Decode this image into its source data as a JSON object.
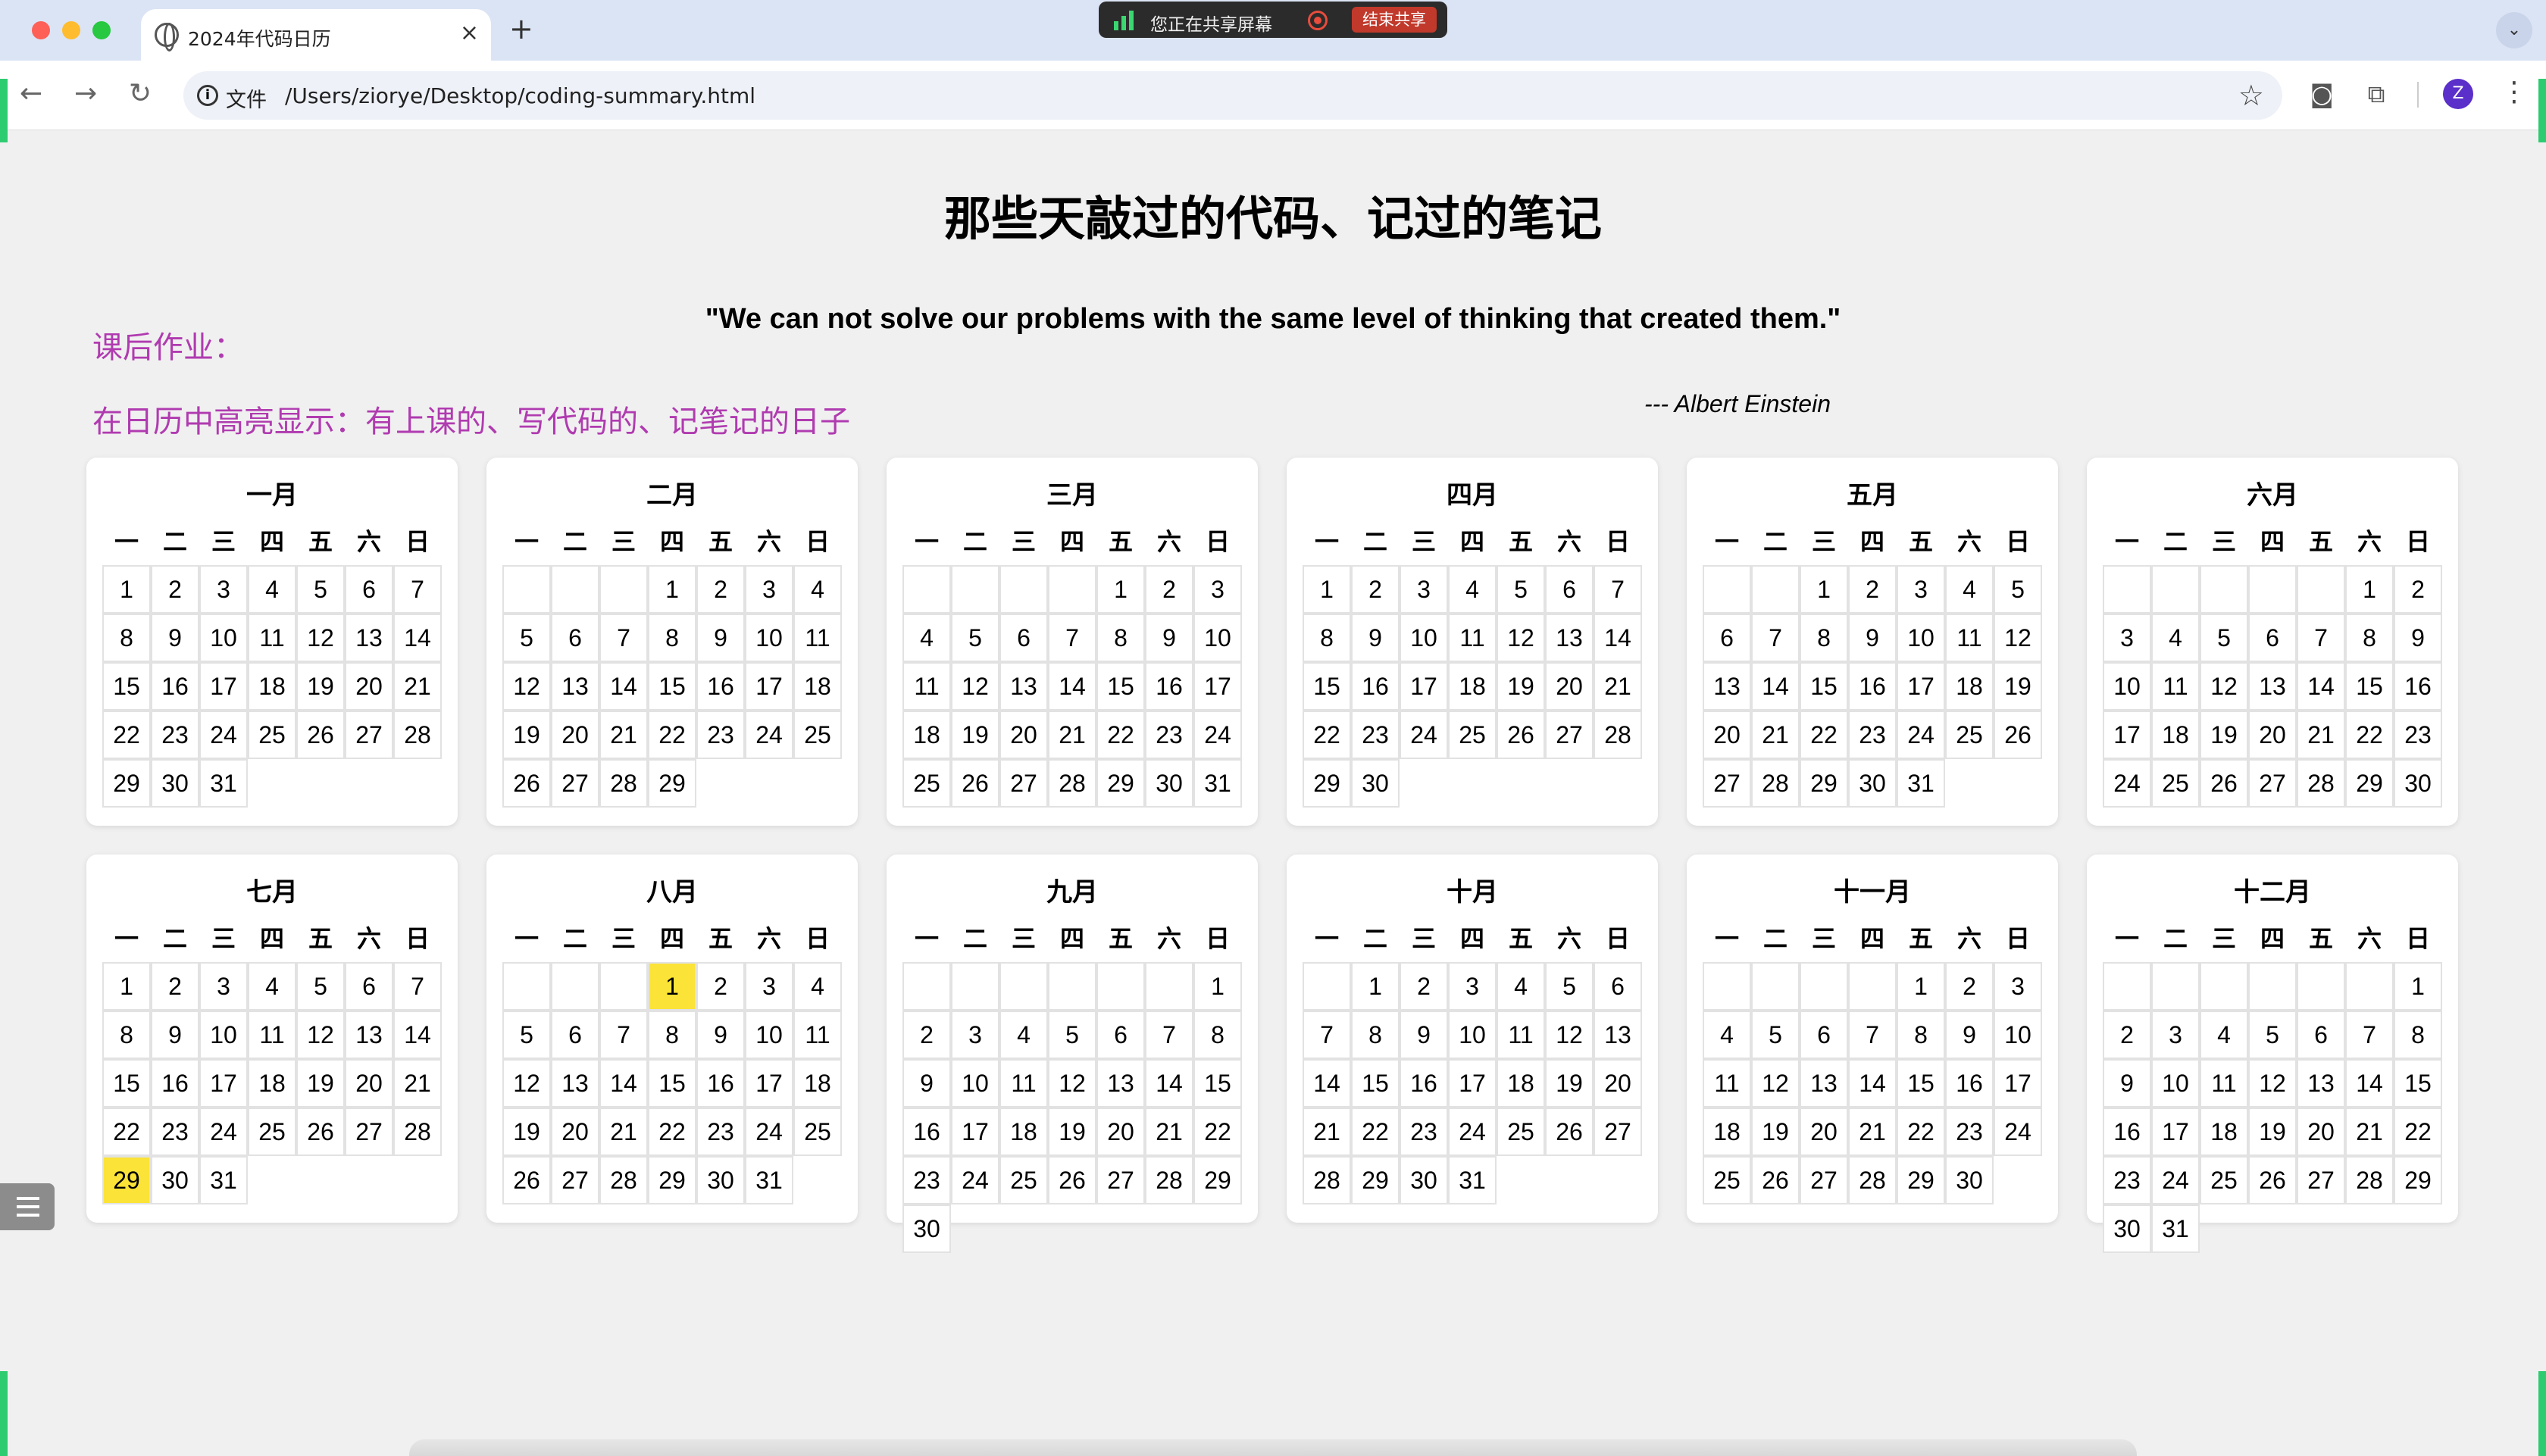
{
  "browser": {
    "tab_title": "2024年代码日历",
    "tab_close": "×",
    "new_tab": "+",
    "tab_menu": "⌄",
    "share_status": "您正在共享屏幕",
    "stop_share": "结束共享",
    "address_scheme": "文件",
    "address_url": "/Users/ziorye/Desktop/coding-summary.html",
    "profile_initial": "Z",
    "nav_back": "←",
    "nav_forward": "→",
    "nav_reload": "↻",
    "info_glyph": "i",
    "bookmark_glyph": "☆",
    "camera_glyph": "◙",
    "extensions_glyph": "⧉",
    "menu_glyph": "⋮"
  },
  "page": {
    "title": "那些天敲过的代码、记过的笔记",
    "quote": "\"We can not solve our problems with the same level of thinking that created them.\"",
    "author": "--- Albert Einstein",
    "homework_label": "课后作业：",
    "homework_task": "在日历中高亮显示：有上课的、写代码的、记笔记的日子"
  },
  "calendar": {
    "weekdays": [
      "一",
      "二",
      "三",
      "四",
      "五",
      "六",
      "日"
    ],
    "months": [
      {
        "name": "一月",
        "start": 0,
        "days": 31,
        "highlight": []
      },
      {
        "name": "二月",
        "start": 3,
        "days": 29,
        "highlight": []
      },
      {
        "name": "三月",
        "start": 4,
        "days": 31,
        "highlight": []
      },
      {
        "name": "四月",
        "start": 0,
        "days": 30,
        "highlight": []
      },
      {
        "name": "五月",
        "start": 2,
        "days": 31,
        "highlight": []
      },
      {
        "name": "六月",
        "start": 5,
        "days": 30,
        "highlight": []
      },
      {
        "name": "七月",
        "start": 0,
        "days": 31,
        "highlight": [
          29
        ]
      },
      {
        "name": "八月",
        "start": 3,
        "days": 31,
        "highlight": [
          1
        ]
      },
      {
        "name": "九月",
        "start": 6,
        "days": 30,
        "highlight": []
      },
      {
        "name": "十月",
        "start": 1,
        "days": 31,
        "highlight": []
      },
      {
        "name": "十一月",
        "start": 4,
        "days": 30,
        "highlight": []
      },
      {
        "name": "十二月",
        "start": 6,
        "days": 31,
        "highlight": []
      }
    ],
    "highlight_color": "#fbe337"
  },
  "colors": {
    "homework_text": "#b03bb0",
    "accent_green": "#2ecc71",
    "share_bar_stop": "#c0392b"
  }
}
